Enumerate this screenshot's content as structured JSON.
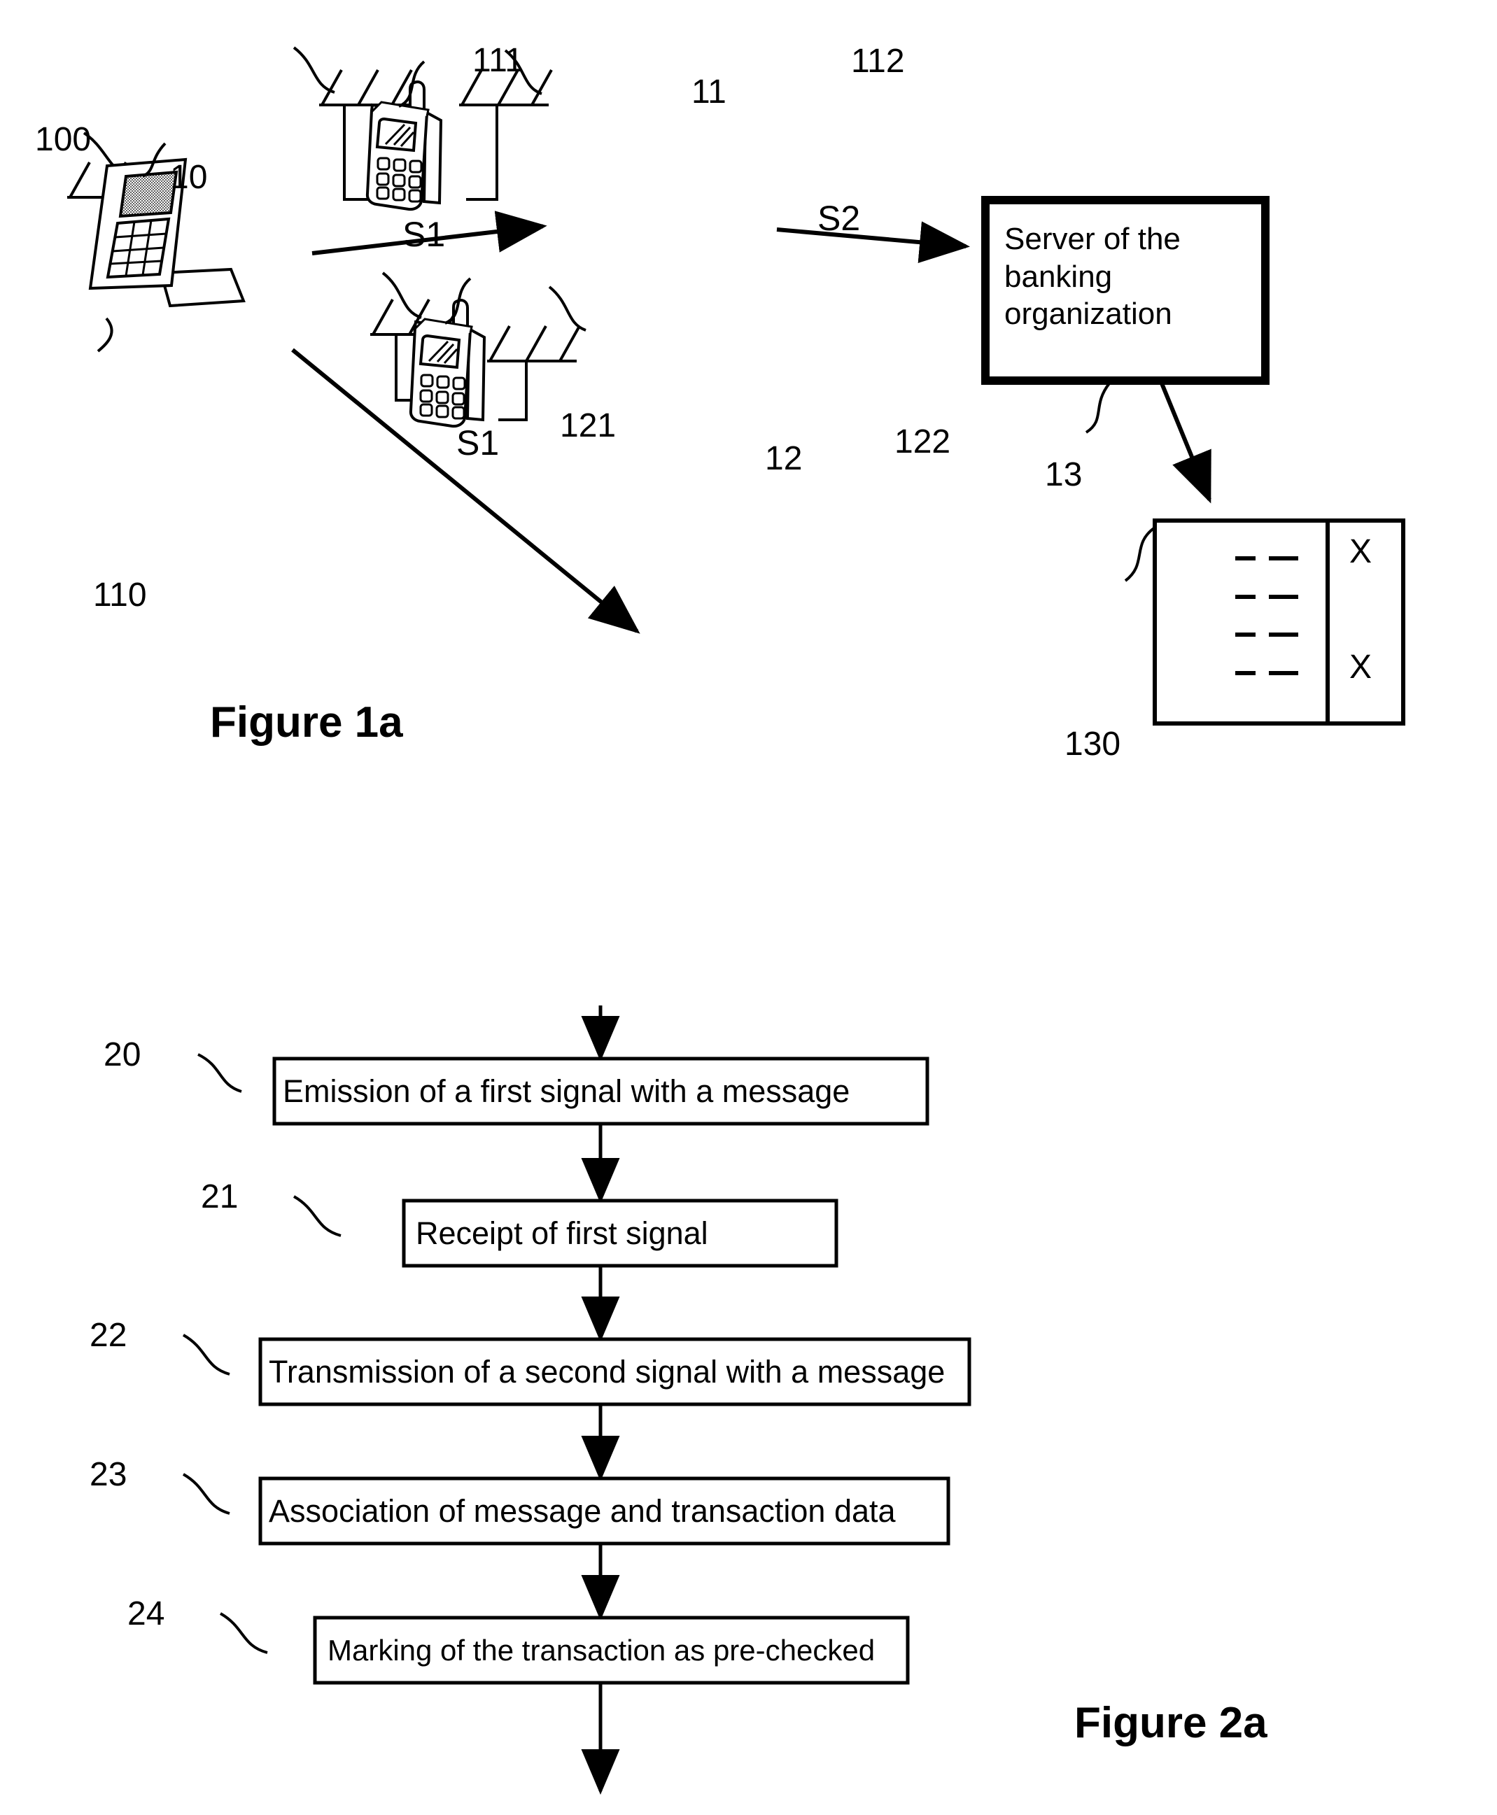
{
  "figure1": {
    "caption": "Figure 1a",
    "signals": [
      {
        "name": "S1",
        "from": "payment-terminal",
        "to": "first-mobile-phone"
      },
      {
        "name": "S1",
        "from": "payment-terminal",
        "to": "second-mobile-phone"
      },
      {
        "name": "S2",
        "from": "first-mobile-phone",
        "to": "server"
      }
    ],
    "server": {
      "label": "Server of the\nbanking\norganization",
      "ref": "13"
    },
    "terminal": {
      "ref": "10",
      "antenna_ref": "100",
      "card_ref": "110"
    },
    "phone1": {
      "ref": "11",
      "antenna_left_ref": "111",
      "antenna_right_ref": "112"
    },
    "phone2": {
      "ref": "12",
      "antenna_left_ref": "121",
      "antenna_right_ref": "122"
    },
    "record": {
      "ref": "130",
      "rows": 4,
      "marks": [
        "X",
        "X"
      ],
      "mark_rows": [
        1,
        4
      ]
    }
  },
  "figure2": {
    "caption": "Figure 2a",
    "steps": [
      {
        "ref": "20",
        "label": "Emission of a first signal with a message"
      },
      {
        "ref": "21",
        "label": "Receipt of first signal"
      },
      {
        "ref": "22",
        "label": "Transmission of a second signal with a message"
      },
      {
        "ref": "23",
        "label": "Association of message and transaction data"
      },
      {
        "ref": "24",
        "label": "Marking of the transaction as pre-checked"
      }
    ]
  }
}
